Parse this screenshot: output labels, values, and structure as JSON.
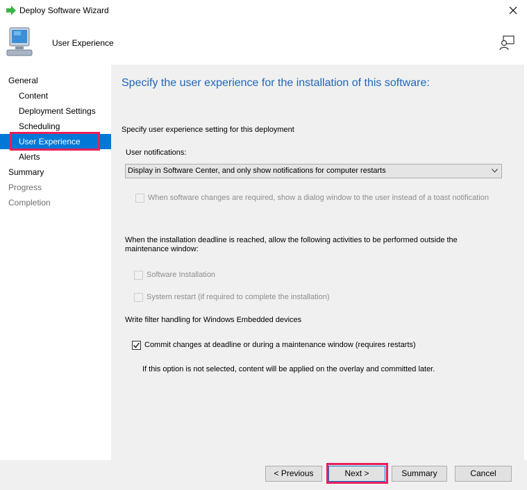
{
  "window": {
    "title": "Deploy Software Wizard",
    "title_icon": "green-arrow-icon",
    "close_icon": "close-icon"
  },
  "header": {
    "title": "User Experience",
    "page_icon": "computer-icon",
    "help_icon": "help-person-icon"
  },
  "nav": {
    "items": [
      {
        "label": "General",
        "level": "top",
        "state": "normal"
      },
      {
        "label": "Content",
        "level": "sub",
        "state": "normal"
      },
      {
        "label": "Deployment Settings",
        "level": "sub",
        "state": "normal"
      },
      {
        "label": "Scheduling",
        "level": "sub",
        "state": "normal"
      },
      {
        "label": "User Experience",
        "level": "sub",
        "state": "selected"
      },
      {
        "label": "Alerts",
        "level": "sub",
        "state": "normal"
      },
      {
        "label": "Summary",
        "level": "top",
        "state": "normal"
      },
      {
        "label": "Progress",
        "level": "top",
        "state": "disabled"
      },
      {
        "label": "Completion",
        "level": "top",
        "state": "disabled"
      }
    ]
  },
  "main": {
    "heading": "Specify the user experience for the installation of this software:",
    "intro": "Specify user experience setting for this deployment",
    "notifications_label": "User notifications:",
    "notifications_value": "Display in Software Center, and only show notifications for computer restarts",
    "dialog_checkbox": {
      "label": "When software changes are required, show a dialog window to the user instead of a toast notification",
      "checked": false,
      "enabled": false
    },
    "deadline_text": "When the installation deadline is reached, allow the following activities to be performed outside the maintenance window:",
    "software_install": {
      "label": "Software Installation",
      "checked": false,
      "enabled": false
    },
    "system_restart": {
      "label": "System restart  (if required to complete the installation)",
      "checked": false,
      "enabled": false
    },
    "write_filter_label": "Write filter handling for Windows Embedded devices",
    "commit_changes": {
      "label": "Commit changes at deadline or during a maintenance window (requires restarts)",
      "checked": true,
      "enabled": true
    },
    "overlay_note": "If this option is not selected, content will be applied on the overlay and committed later."
  },
  "footer": {
    "previous": "< Previous",
    "next": "Next >",
    "summary": "Summary",
    "cancel": "Cancel"
  },
  "colors": {
    "accent": "#0078d7",
    "heading": "#1f66b8",
    "annotation": "#e8205a"
  }
}
